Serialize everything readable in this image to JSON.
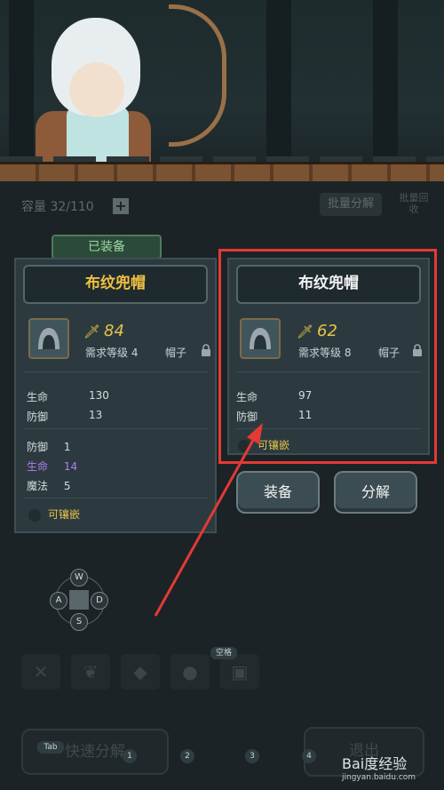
{
  "capacity": {
    "label": "容量 32/110",
    "add_label": "+"
  },
  "toolbar": {
    "batch_label": "批量分解",
    "batch2_label": "批量回收"
  },
  "equipped_tag": "已装备",
  "equipped_item": {
    "name": "布纹兜帽",
    "power": "84",
    "req_level": "需求等级 4",
    "slot_type": "帽子",
    "base_stats": [
      {
        "label": "生命",
        "value": "130"
      },
      {
        "label": "防御",
        "value": "13"
      }
    ],
    "bonus_stats": [
      {
        "label": "防御",
        "value": "1",
        "color": "#d4dcde"
      },
      {
        "label": "生命",
        "value": "14",
        "color": "#b07cf0"
      },
      {
        "label": "魔法",
        "value": "5",
        "color": "#d4dcde"
      }
    ],
    "socket": "可镶嵌"
  },
  "selected_item": {
    "name": "布纹兜帽",
    "power": "62",
    "req_level": "需求等级 8",
    "slot_type": "帽子",
    "base_stats": [
      {
        "label": "生命",
        "value": "97"
      },
      {
        "label": "防御",
        "value": "11"
      }
    ],
    "socket": "可镶嵌"
  },
  "actions": {
    "equip": "装备",
    "decompose": "分解"
  },
  "dpad": {
    "up": "W",
    "left": "A",
    "right": "D",
    "down": "S"
  },
  "hotkeys": {
    "space": "空格",
    "tab": "Tab",
    "slots": [
      "1",
      "2",
      "3",
      "4"
    ]
  },
  "bottom": {
    "quick_decompose": "快速分解",
    "exit": "退出"
  },
  "watermark": {
    "main": "Bai度经验",
    "sub": "jingyan.baidu.com"
  },
  "colors": {
    "highlight": "#e53935",
    "gold": "#e8c24a",
    "purple": "#b07cf0"
  }
}
